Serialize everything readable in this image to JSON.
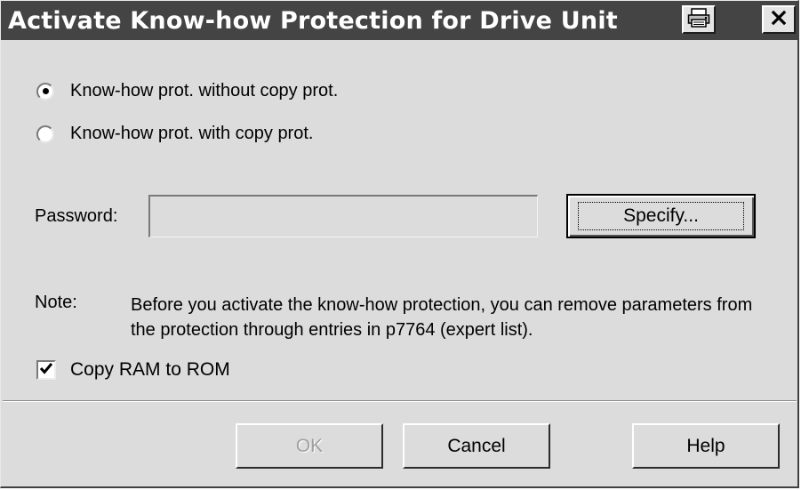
{
  "dialog": {
    "title": "Activate Know-how Protection for Drive Unit",
    "title_buttons": [
      {
        "name": "print",
        "icon": "printer-icon"
      },
      {
        "name": "close",
        "label": "×",
        "icon": "close-icon"
      }
    ]
  },
  "protection_mode": {
    "options": [
      {
        "label": "Know-how prot. without copy prot.",
        "selected": true
      },
      {
        "label": "Know-how prot. with copy prot.",
        "selected": false
      }
    ]
  },
  "password": {
    "label": "Password:",
    "value": "",
    "specify_label": "Specify..."
  },
  "note": {
    "label": "Note:",
    "text": "Before you activate the know-how protection, you can remove parameters from the protection through entries in p7764 (expert list)."
  },
  "copy_ram_to_rom": {
    "label": "Copy RAM to ROM",
    "checked": true
  },
  "footer": {
    "ok_label": "OK",
    "ok_enabled": false,
    "cancel_label": "Cancel",
    "help_label": "Help"
  },
  "colors": {
    "titlebar": "#444444",
    "dialog_bg": "#dcdcdc",
    "disabled_text": "#a0a0a0"
  }
}
